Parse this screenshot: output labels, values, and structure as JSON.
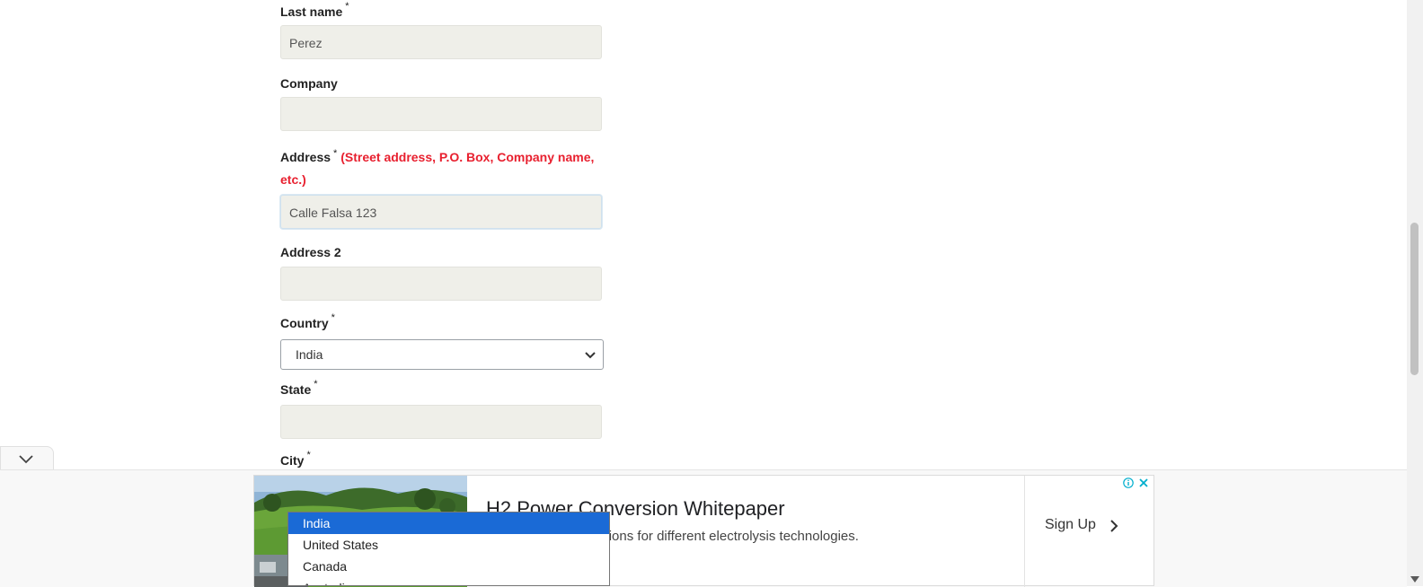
{
  "form": {
    "last_name": {
      "label": "Last name",
      "required": "*",
      "value": "Perez"
    },
    "company": {
      "label": "Company",
      "value": ""
    },
    "address": {
      "label": "Address",
      "required": "*",
      "hint": "(Street address, P.O. Box, Company name, etc.)",
      "value": "Calle Falsa 123"
    },
    "address2": {
      "label": "Address 2",
      "value": ""
    },
    "country": {
      "label": "Country",
      "required": "*",
      "value": "India"
    },
    "state": {
      "label": "State",
      "required": "*",
      "value": ""
    },
    "city": {
      "label": "City",
      "required": "*"
    }
  },
  "dropdown": {
    "options": [
      "India",
      "United States",
      "Canada",
      "Australia"
    ],
    "selected": "India"
  },
  "ad": {
    "title": "H2 Power Conversion Whitepaper",
    "description_visible": "wer conversion solutions for different electrolysis technologies.",
    "cta": "Sign Up",
    "info_icon": "info-icon",
    "close_icon": "close-icon"
  },
  "colors": {
    "hint_red": "#e8202f",
    "input_bg": "#efefe9",
    "selected_option": "#1a6ad6"
  }
}
